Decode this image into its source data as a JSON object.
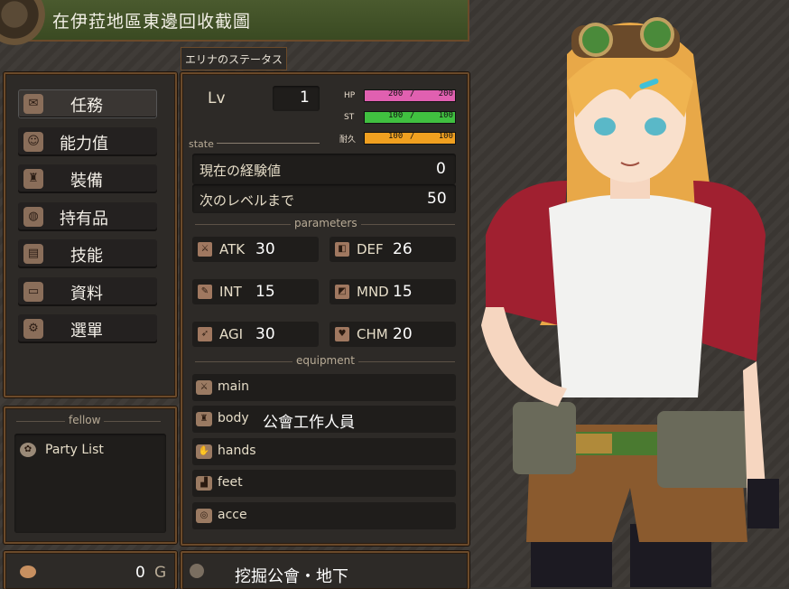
{
  "header": {
    "location_title": "在伊菈地區東邊回收截圖"
  },
  "status_tab": {
    "label": "エリナのステータス"
  },
  "menu": {
    "items": [
      {
        "label": "任務",
        "icon": "scroll-icon"
      },
      {
        "label": "能力值",
        "icon": "face-icon"
      },
      {
        "label": "裝備",
        "icon": "armor-icon"
      },
      {
        "label": "持有品",
        "icon": "bag-icon"
      },
      {
        "label": "技能",
        "icon": "book-icon"
      },
      {
        "label": "資料",
        "icon": "folder-icon"
      },
      {
        "label": "選單",
        "icon": "gear-icon"
      }
    ]
  },
  "fellow": {
    "title": "fellow",
    "party_list": "Party List"
  },
  "gold": {
    "amount": "0",
    "unit": "G"
  },
  "location_footer": {
    "text": "挖掘公會・地下"
  },
  "status": {
    "lv_label": "Lv",
    "lv_value": "1",
    "state_label": "state",
    "hp": {
      "label": "HP",
      "current": "200",
      "max": "200",
      "fraction": 1.0,
      "color": "#e060b0"
    },
    "st": {
      "label": "ST",
      "current": "100",
      "max": "100",
      "fraction": 1.0,
      "color": "#40c040"
    },
    "dur": {
      "label": "耐久",
      "current": "100",
      "max": "100",
      "fraction": 1.0,
      "color": "#f0a020"
    },
    "exp_label": "現在の経験値",
    "exp_value": "0",
    "next_label": "次のレベルまで",
    "next_value": "50"
  },
  "parameters": {
    "title": "parameters",
    "atk": {
      "name": "ATK",
      "value": "30"
    },
    "def": {
      "name": "DEF",
      "value": "26"
    },
    "int": {
      "name": "INT",
      "value": "15"
    },
    "mnd": {
      "name": "MND",
      "value": "15"
    },
    "agi": {
      "name": "AGI",
      "value": "30"
    },
    "chm": {
      "name": "CHM",
      "value": "20"
    }
  },
  "equipment": {
    "title": "equipment",
    "main": {
      "slot": "main",
      "item": ""
    },
    "body": {
      "slot": "body",
      "item": "公會工作人員"
    },
    "hands": {
      "slot": "hands",
      "item": ""
    },
    "feet": {
      "slot": "feet",
      "item": ""
    },
    "acce": {
      "slot": "acce",
      "item": ""
    }
  }
}
